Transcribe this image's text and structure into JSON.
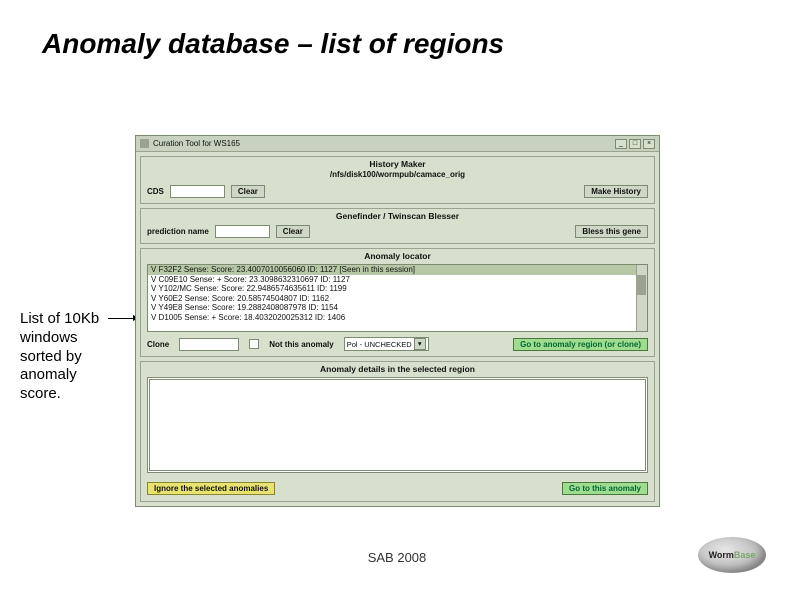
{
  "slide": {
    "title": "Anomaly database – list of regions",
    "annotation": "List of 10Kb windows sorted by anomaly score.",
    "footer": "SAB 2008",
    "logo": "WormBase"
  },
  "app": {
    "window_title": "Curation Tool for WS165",
    "window_controls": {
      "min": "_",
      "max": "□",
      "close": "×"
    },
    "history": {
      "title": "History Maker",
      "path": "/nfs/disk100/wormpub/camace_orig",
      "cds_label": "CDS",
      "clear": "Clear",
      "make": "Make History"
    },
    "blesser": {
      "title": "Genefinder / Twinscan Blesser",
      "pred_label": "prediction name",
      "clear": "Clear",
      "bless": "Bless this gene"
    },
    "locator": {
      "title": "Anomaly locator",
      "items": [
        "V F32F2 Sense:    Score: 23.4007010056060 ID: 1127 [Seen in this session]",
        "V C09E10 Sense: + Score: 23.3098632310697 ID: 1127",
        "V Y102/MC Sense:    Score: 22.9486574635611 ID: 1199",
        "V Y60E2 Sense:    Score: 20.58574504807 ID: 1162",
        "V Y49E8 Sense:    Score: 19.2882408087978 ID: 1154",
        "V D1005 Sense: + Score: 18.4032020025312 ID: 1406"
      ],
      "clone_label": "Clone",
      "not_this_label": "Not this anomaly",
      "dropdown_value": "Pol - UNCHECKED",
      "go_region": "Go to anomaly region (or clone)"
    },
    "details": {
      "title": "Anomaly details in the selected region"
    },
    "bottom": {
      "ignore": "Ignore the selected anomalies",
      "go_this": "Go to this anomaly"
    }
  }
}
